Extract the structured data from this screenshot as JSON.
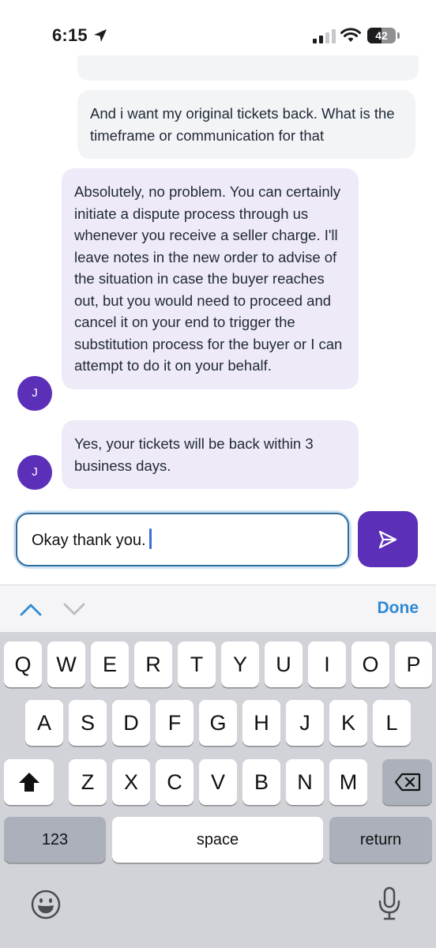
{
  "status_bar": {
    "time": "6:15",
    "battery": "42",
    "location_icon": "location-arrow-icon",
    "signal_icon": "cellular-signal-icon",
    "wifi_icon": "wifi-icon"
  },
  "chat": {
    "messages": [
      {
        "sender": "user",
        "text": "And i want my original tickets back. What is the timeframe or communication for that"
      },
      {
        "sender": "agent",
        "avatar": "J",
        "text": "Absolutely, no problem. You can certainly initiate a dispute process through us whenever you receive a seller charge. I'll leave notes in the new order to advise of the situation in case the buyer reaches out, but you would need to proceed and cancel it on your end to trigger the substitution process for the buyer or I can attempt to do it on your behalf."
      },
      {
        "sender": "agent",
        "avatar": "J",
        "text": "Yes, your tickets will be back within 3 business days."
      }
    ]
  },
  "composer": {
    "value": "Okay thank you.",
    "send_icon": "send-icon"
  },
  "accessory": {
    "done_label": "Done",
    "up_icon": "chevron-up-icon",
    "down_icon": "chevron-down-icon"
  },
  "keyboard": {
    "row1": [
      "Q",
      "W",
      "E",
      "R",
      "T",
      "Y",
      "U",
      "I",
      "O",
      "P"
    ],
    "row2": [
      "A",
      "S",
      "D",
      "F",
      "G",
      "H",
      "J",
      "K",
      "L"
    ],
    "row3": [
      "Z",
      "X",
      "C",
      "V",
      "B",
      "N",
      "M"
    ],
    "numbers_label": "123",
    "space_label": "space",
    "return_label": "return",
    "shift_icon": "shift-icon",
    "delete_icon": "backspace-icon",
    "emoji_icon": "emoji-icon",
    "mic_icon": "microphone-icon"
  },
  "colors": {
    "accent": "#5b2fb8",
    "agent_bubble": "#efeaf8",
    "user_bubble": "#f3f4f6",
    "done_blue": "#2f8ad4",
    "input_border": "#2f6c9b"
  }
}
